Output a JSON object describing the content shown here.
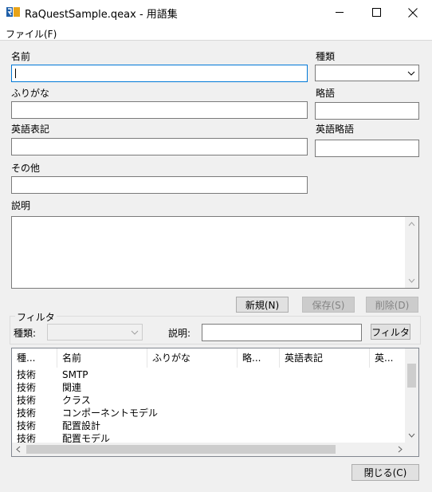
{
  "window": {
    "title": "RaQuestSample.qeax - 用語集",
    "icon_text": "R",
    "minimize_icon": "minimize-icon",
    "maximize_icon": "maximize-icon",
    "close_icon": "close-icon"
  },
  "menu": {
    "file_label": "ファイル(F)"
  },
  "form": {
    "name_label": "名前",
    "name_value": "",
    "kind_label": "種類",
    "kind_value": "",
    "furigana_label": "ふりがな",
    "furigana_value": "",
    "abbr_label": "略語",
    "abbr_value": "",
    "english_label": "英語表記",
    "english_value": "",
    "english_abbr_label": "英語略語",
    "english_abbr_value": "",
    "other_label": "その他",
    "other_value": "",
    "description_label": "説明",
    "description_value": ""
  },
  "actions": {
    "new_label": "新規(N)",
    "save_label": "保存(S)",
    "delete_label": "削除(D)"
  },
  "filter": {
    "group_label": "フィルタ",
    "kind_label": "種類:",
    "kind_value": "",
    "description_label": "説明:",
    "description_value": "",
    "button_label": "フィルタ"
  },
  "table": {
    "columns": [
      "種...",
      "名前",
      "ふりがな",
      "略...",
      "英語表記",
      "英..."
    ],
    "rows": [
      {
        "kind": "技術",
        "name": "SMTP"
      },
      {
        "kind": "技術",
        "name": "関連"
      },
      {
        "kind": "技術",
        "name": "クラス"
      },
      {
        "kind": "技術",
        "name": "コンポーネントモデル"
      },
      {
        "kind": "技術",
        "name": "配置設計"
      },
      {
        "kind": "技術",
        "name": "配置モデル"
      }
    ]
  },
  "footer": {
    "close_label": "閉じる(C)"
  },
  "colors": {
    "accent": "#0078d7",
    "window_bg": "#f0f0f0",
    "disabled_text": "#838383"
  }
}
